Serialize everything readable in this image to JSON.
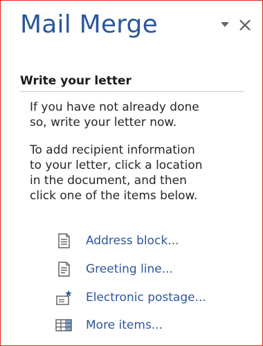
{
  "pane": {
    "title": "Mail Merge",
    "close_glyph": "×"
  },
  "section": {
    "heading": "Write your letter",
    "para1": "If you have not already done\nso, write your letter now.",
    "para2": "To add recipient information\nto your letter, click a location\nin the document, and then\nclick one of the items below."
  },
  "items": [
    {
      "label": "Address block...",
      "icon": "address-block-icon"
    },
    {
      "label": "Greeting line...",
      "icon": "greeting-line-icon"
    },
    {
      "label": "Electronic postage...",
      "icon": "electronic-postage-icon"
    },
    {
      "label": "More items...",
      "icon": "more-items-icon"
    }
  ],
  "colors": {
    "accent": "#2b579a",
    "border": "#e0201a",
    "text": "#262626"
  }
}
